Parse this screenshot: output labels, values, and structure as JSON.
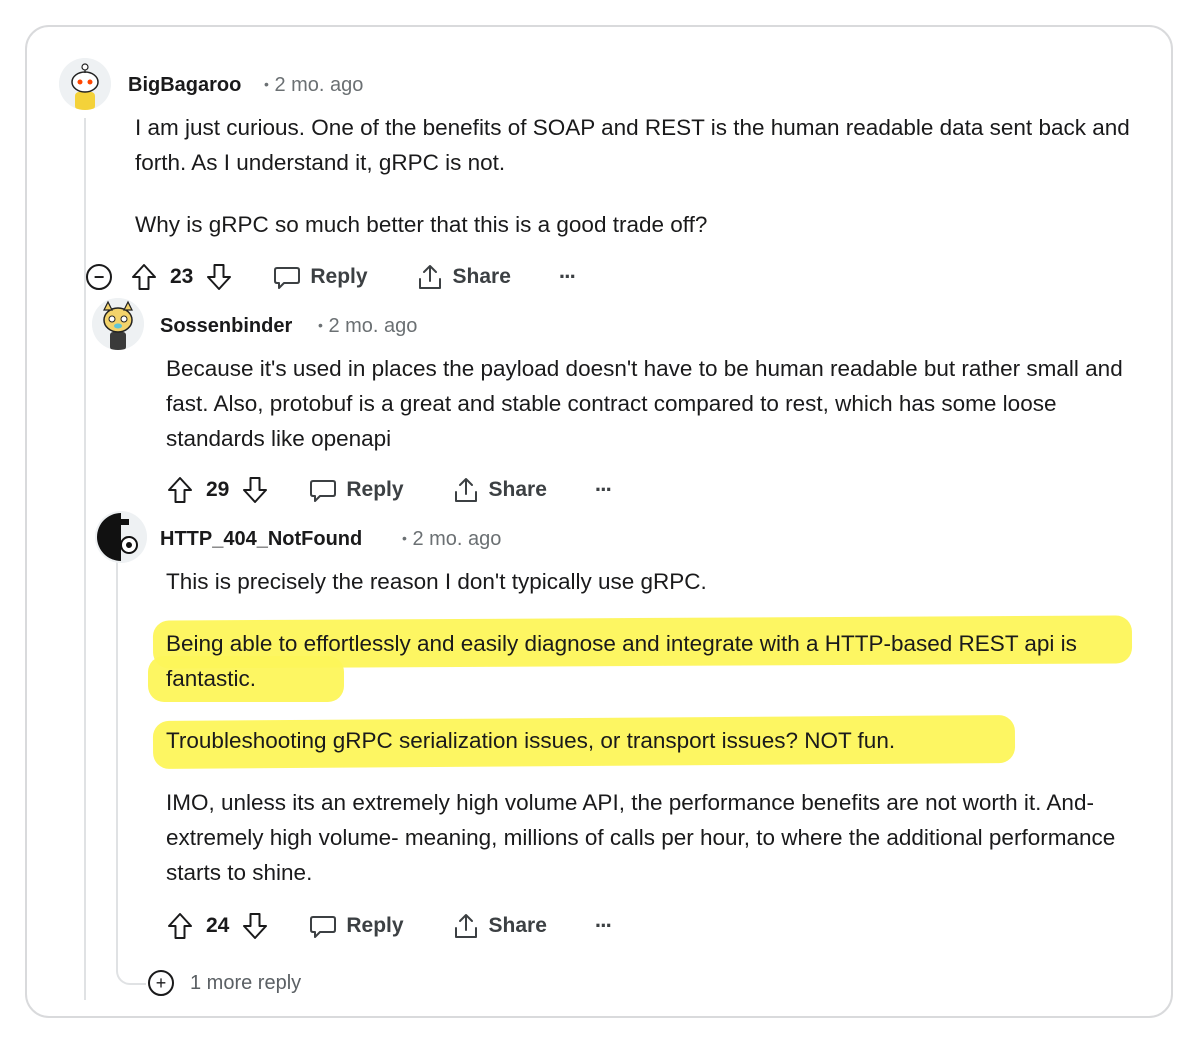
{
  "comments": [
    {
      "author": "BigBagaroo",
      "time": "2 mo. ago",
      "paragraphs": [
        "I am just curious. One of the benefits of SOAP and REST is the human readable data sent back and forth. As I understand it, gRPC is not.",
        "Why is gRPC so much better that this is a good trade off?"
      ],
      "votes": "23",
      "reply_label": "Reply",
      "share_label": "Share",
      "more_label": "···",
      "collapse_label": "−"
    },
    {
      "author": "Sossenbinder",
      "time": "2 mo. ago",
      "paragraphs": [
        "Because it's used in places the payload doesn't have to be human readable but rather small and fast. Also, protobuf is a great and stable contract compared to rest, which has some loose standards like openapi"
      ],
      "votes": "29",
      "reply_label": "Reply",
      "share_label": "Share",
      "more_label": "···"
    },
    {
      "author": "HTTP_404_NotFound",
      "time": "2 mo. ago",
      "paragraphs": [
        "This is precisely the reason I don't typically use gRPC.",
        "Being able to effortlessly and easily diagnose and integrate with a HTTP-based REST api is fantastic.",
        "Troubleshooting gRPC serialization issues, or transport issues? NOT fun.",
        "IMO, unless its an extremely high volume API, the performance benefits are not worth it. And- extremely high volume- meaning, millions of calls per hour, to where the additional performance starts to shine."
      ],
      "votes": "24",
      "reply_label": "Reply",
      "share_label": "Share",
      "more_label": "···"
    }
  ],
  "more_replies": {
    "label": "1 more reply",
    "icon": "+"
  },
  "dot_separator": "•",
  "highlight_color": "#fdf65a"
}
